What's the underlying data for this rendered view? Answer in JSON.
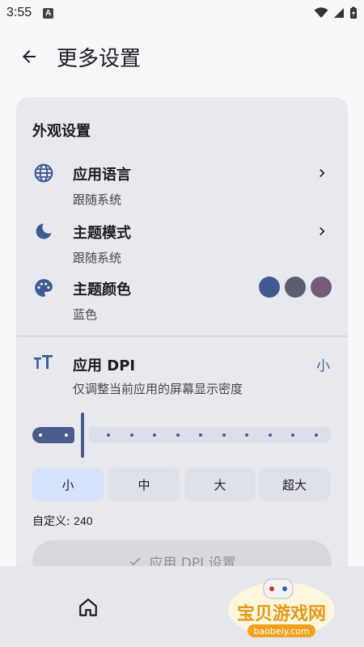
{
  "status": {
    "time": "3:55",
    "notification_badge": "A"
  },
  "header": {
    "title": "更多设置"
  },
  "appearance": {
    "section_title": "外观设置",
    "language": {
      "title": "应用语言",
      "value": "跟随系统",
      "icon": "globe-icon"
    },
    "theme_mode": {
      "title": "主题模式",
      "value": "跟随系统",
      "icon": "moon-icon"
    },
    "theme_color": {
      "title": "主题颜色",
      "value": "蓝色",
      "icon": "palette-icon",
      "swatches": [
        "#3f5b91",
        "#5a5f6e",
        "#775a7a"
      ]
    }
  },
  "dpi": {
    "title": "应用 DPI",
    "current": "小",
    "description": "仅调整当前应用的屏幕显示密度",
    "options": [
      "小",
      "中",
      "大",
      "超大"
    ],
    "selected": "小",
    "custom_label": "自定义: ",
    "custom_value": "240",
    "apply_label": "应用 DPI 设置"
  },
  "nav": {
    "home_icon": "home-icon"
  },
  "watermark": {
    "text": "宝贝游戏网",
    "url": "baobeiy.com"
  },
  "colors": {
    "accent": "#4a5b8c",
    "card": "#e8e9ee",
    "selected_segment": "#d7e2fb"
  }
}
